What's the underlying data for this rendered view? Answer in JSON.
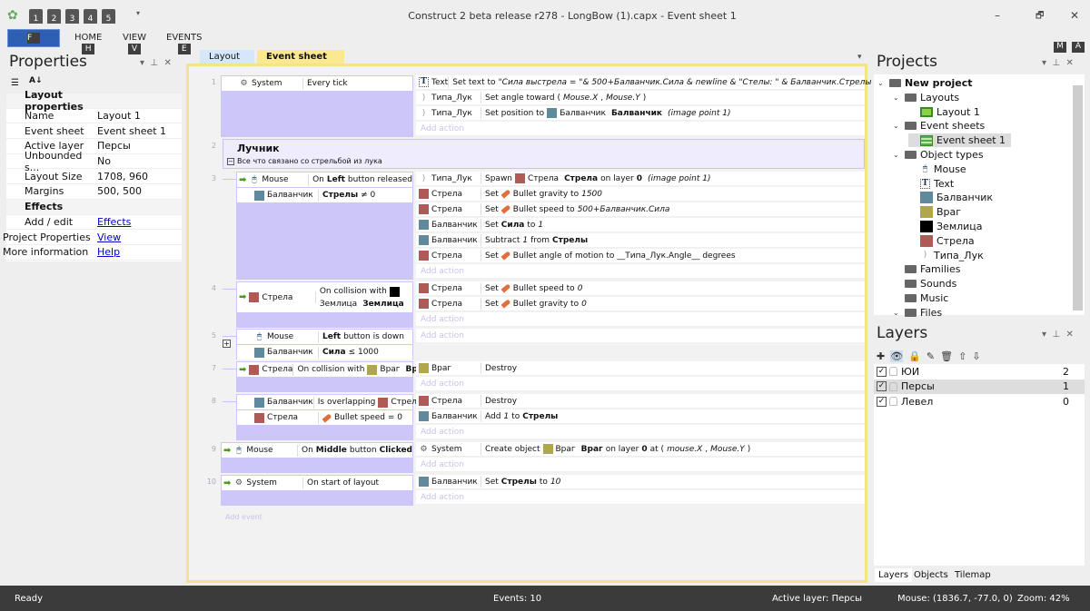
{
  "app": {
    "title": "Construct 2 beta release r278 - LongBow (1).capx - Event sheet 1",
    "quick_access_keys": [
      "1",
      "2",
      "3",
      "4",
      "5"
    ],
    "ribbon": [
      {
        "label": "F",
        "key": ""
      },
      {
        "label": "HOME",
        "key": "H"
      },
      {
        "label": "VIEW",
        "key": "V"
      },
      {
        "label": "EVENTS",
        "key": "E"
      }
    ],
    "right_keys": [
      "M",
      "A"
    ],
    "window_controls": [
      "–",
      "🗗",
      "✕"
    ]
  },
  "properties": {
    "title": "Properties",
    "rows": [
      {
        "k": "Layout properties",
        "cat": true
      },
      {
        "k": "Name",
        "v": "Layout 1"
      },
      {
        "k": "Event sheet",
        "v": "Event sheet 1"
      },
      {
        "k": "Active layer",
        "v": "Персы"
      },
      {
        "k": "Unbounded s...",
        "v": "No"
      },
      {
        "k": "Layout Size",
        "v": "1708, 960"
      },
      {
        "k": "Margins",
        "v": "500, 500"
      },
      {
        "k": "Effects",
        "cat": true
      },
      {
        "k": "Add / edit",
        "v": "Effects",
        "link": true
      },
      {
        "k": "Project Properties",
        "v": "View",
        "link": true,
        "top": true
      },
      {
        "k": "More information",
        "v": "Help",
        "link": true,
        "top": true
      }
    ]
  },
  "tabs": [
    {
      "label": "Layout 1"
    },
    {
      "label": "Event sheet 1",
      "active": true
    }
  ],
  "colors": {
    "Балванчик": "#5f8a9e",
    "Враг": "#b0a64c",
    "Землица": "#000000",
    "Стрела": "#b05a58",
    "sheet_border": "#f4e38a",
    "condition_fill": "#cdc6f8"
  },
  "event_sheet": {
    "add_action": "Add action",
    "add_event": "Add event",
    "events": [
      {
        "n": "1",
        "indent": 0,
        "conds": [
          {
            "icon": "gear",
            "obj": "System",
            "text": "Every tick"
          }
        ],
        "acts": [
          {
            "icon": "text",
            "obj": "Text",
            "text": "Set text to __\"Сила выстрела = \"& 500+Балванчик.Сила & newline & \"Стелы: \" & Балванчик.Стрелы__"
          },
          {
            "icon": "bow",
            "obj": "Типа_Лук",
            "text": "Set angle toward (__Mouse.X__, __Mouse.Y__)"
          },
          {
            "icon": "bow",
            "obj": "Типа_Лук",
            "text": "Set position to [[Балванчик]] **Балванчик** __(image point 1)__"
          }
        ]
      },
      {
        "n": "2",
        "group": true,
        "title": "Лучник",
        "desc": "Все что связано со стрельбой из лука"
      },
      {
        "n": "3",
        "indent": 1,
        "trigger": true,
        "conds": [
          {
            "icon": "mouse",
            "obj": "Mouse",
            "text": "On **Left** button released"
          },
          {
            "icon": "Балванчик",
            "obj": "Балванчик",
            "text": "**Стрелы** ≠ 0"
          }
        ],
        "acts": [
          {
            "icon": "bow",
            "obj": "Типа_Лук",
            "text": "Spawn [[Стрела]] **Стрела** on layer **0** __(image point 1)__"
          },
          {
            "icon": "Стрела",
            "obj": "Стрела",
            "text": "Set {{b}} Bullet gravity to __1500__"
          },
          {
            "icon": "Стрела",
            "obj": "Стрела",
            "text": "Set {{b}} Bullet speed to __500+Балванчик.Сила__"
          },
          {
            "icon": "Балванчик",
            "obj": "Балванчик",
            "text": "Set **Сила** to __1__"
          },
          {
            "icon": "Балванчик",
            "obj": "Балванчик",
            "text": "Subtract __1__ from **Стрелы**"
          },
          {
            "icon": "Стрела",
            "obj": "Стрела",
            "text": "Set {{b}} Bullet angle of motion to __Типа_Лук.Angle__ degrees"
          }
        ]
      },
      {
        "n": "4",
        "indent": 1,
        "trigger": true,
        "tall": true,
        "conds": [
          {
            "icon": "Стрела",
            "obj": "Стрела",
            "text": "On collision with [[Землица]] **Землица**"
          }
        ],
        "acts": [
          {
            "icon": "Стрела",
            "obj": "Стрела",
            "text": "Set {{b}} Bullet speed to __0__"
          },
          {
            "icon": "Стрела",
            "obj": "Стрела",
            "text": "Set {{b}} Bullet gravity to __0__"
          }
        ]
      },
      {
        "n": "5",
        "indent": 1,
        "collapsed": true,
        "conds": [
          {
            "icon": "mouse",
            "obj": "Mouse",
            "text": "**Left** button is down"
          },
          {
            "icon": "Балванчик",
            "obj": "Балванчик",
            "text": "**Сила** ≤ 1000"
          }
        ],
        "acts": [],
        "noadd": true
      },
      {
        "n": "7",
        "indent": 1,
        "trigger": true,
        "conds": [
          {
            "icon": "Стрела",
            "obj": "Стрела",
            "text": "On collision with [[Враг]] **Враг**"
          }
        ],
        "acts": [
          {
            "icon": "Враг",
            "obj": "Враг",
            "text": "Destroy"
          }
        ]
      },
      {
        "n": "8",
        "indent": 1,
        "conds": [
          {
            "icon": "Балванчик",
            "obj": "Балванчик",
            "text": "Is overlapping [[Стрела]] **Стрела**"
          },
          {
            "icon": "Стрела",
            "obj": "Стрела",
            "text": "{{b}} Bullet speed = 0"
          }
        ],
        "acts": [
          {
            "icon": "Стрела",
            "obj": "Стрела",
            "text": "Destroy"
          },
          {
            "icon": "Балванчик",
            "obj": "Балванчик",
            "text": "Add __1__ to **Стрелы**"
          }
        ]
      },
      {
        "n": "9",
        "indent": 0,
        "trigger": true,
        "conds": [
          {
            "icon": "mouse",
            "obj": "Mouse",
            "text": "On **Middle** button **Clicked**"
          }
        ],
        "acts": [
          {
            "icon": "gear",
            "obj": "System",
            "text": "Create object [[Враг]] **Враг** on layer **0** at (__mouse.X__, __Mouse.Y__)"
          }
        ]
      },
      {
        "n": "10",
        "indent": 0,
        "trigger": true,
        "conds": [
          {
            "icon": "gear",
            "obj": "System",
            "text": "On start of layout"
          }
        ],
        "acts": [
          {
            "icon": "Балванчик",
            "obj": "Балванчик",
            "text": "Set **Стрелы** to __10__"
          }
        ]
      }
    ]
  },
  "projects": {
    "title": "Projects",
    "tree": [
      {
        "label": "New project",
        "lvl": 0,
        "icon": "folder",
        "bold": true,
        "exp": true
      },
      {
        "label": "Layouts",
        "lvl": 1,
        "icon": "folder",
        "exp": true
      },
      {
        "label": "Layout 1",
        "lvl": 2,
        "icon": "layout"
      },
      {
        "label": "Event sheets",
        "lvl": 1,
        "icon": "folder",
        "exp": true
      },
      {
        "label": "Event sheet 1",
        "lvl": 2,
        "icon": "sheet",
        "sel": true
      },
      {
        "label": "Object types",
        "lvl": 1,
        "icon": "folder",
        "exp": true
      },
      {
        "label": "Mouse",
        "lvl": 2,
        "icon": "mouse"
      },
      {
        "label": "Text",
        "lvl": 2,
        "icon": "text"
      },
      {
        "label": "Балванчик",
        "lvl": 2,
        "icon": "Балванчик"
      },
      {
        "label": "Враг",
        "lvl": 2,
        "icon": "Враг"
      },
      {
        "label": "Землица",
        "lvl": 2,
        "icon": "Землица"
      },
      {
        "label": "Стрела",
        "lvl": 2,
        "icon": "Стрела"
      },
      {
        "label": "Типа_Лук",
        "lvl": 2,
        "icon": "bow"
      },
      {
        "label": "Families",
        "lvl": 1,
        "icon": "folder"
      },
      {
        "label": "Sounds",
        "lvl": 1,
        "icon": "folder"
      },
      {
        "label": "Music",
        "lvl": 1,
        "icon": "folder"
      },
      {
        "label": "Files",
        "lvl": 1,
        "icon": "folder",
        "exp": true
      }
    ]
  },
  "layers": {
    "title": "Layers",
    "tools": [
      "add-icon",
      "eye-icon",
      "lock-icon",
      "pencil-icon",
      "trash-icon",
      "arrow-up-icon",
      "arrow-down-icon"
    ],
    "rows": [
      {
        "name": "ЮИ",
        "idx": "2"
      },
      {
        "name": "Персы",
        "idx": "1",
        "sel": true
      },
      {
        "name": "Левел",
        "idx": "0"
      }
    ],
    "tabs": [
      "Layers",
      "Objects",
      "Tilemap"
    ]
  },
  "status": {
    "ready": "Ready",
    "events": "Events: 10",
    "layer": "Active layer: Персы",
    "mouse": "Mouse: (1836.7, -77.0, 0)",
    "zoom": "Zoom: 42%"
  }
}
